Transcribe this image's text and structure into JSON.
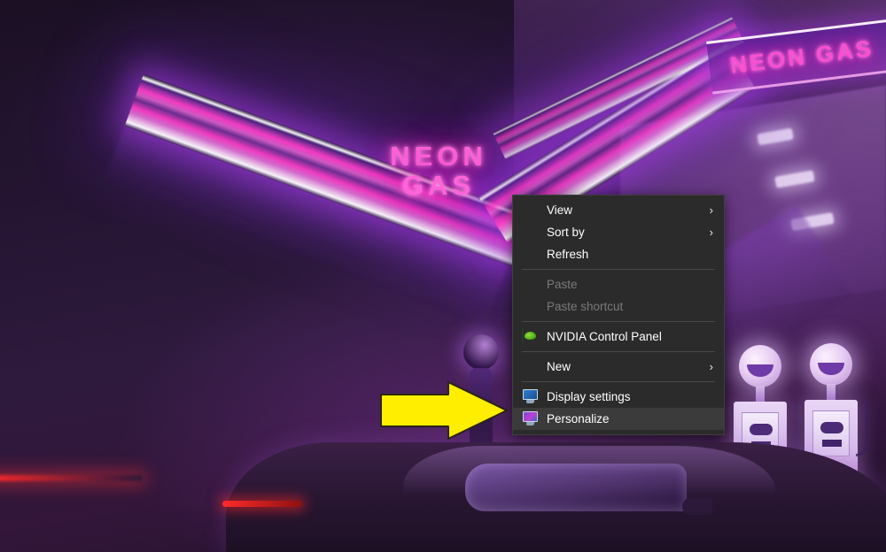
{
  "wallpaper": {
    "scene_name": "neon-gas-station-synthwave",
    "signs": [
      {
        "id": "center-sign",
        "line1": "NEON",
        "line2": "GAS",
        "color": "#ff63d9"
      },
      {
        "id": "corner-sign",
        "text": "NEON GAS",
        "color": "#f94fd0"
      }
    ],
    "accent_colors": {
      "neon_pink": "#ff3ec4",
      "neon_purple": "#8a3ddb",
      "background_dark": "#1b1024",
      "tail_light_red": "#ff2a2a"
    }
  },
  "annotation": {
    "arrow": {
      "name": "yellow-right-arrow",
      "direction": "right",
      "fill": "#ffee00",
      "stroke": "#2a2416",
      "points_at": "Personalize"
    }
  },
  "context_menu": {
    "name": "desktop-context-menu",
    "background": "#2b2b2b",
    "border": "#3f3f3f",
    "items": [
      {
        "label": "View",
        "icon": "none",
        "submenu": true,
        "disabled": false,
        "highlight": false,
        "chevron": "›"
      },
      {
        "label": "Sort by",
        "icon": "none",
        "submenu": true,
        "disabled": false,
        "highlight": false,
        "chevron": "›"
      },
      {
        "label": "Refresh",
        "icon": "none",
        "submenu": false,
        "disabled": false,
        "highlight": false,
        "chevron": ""
      },
      {
        "label": "Paste",
        "icon": "none",
        "submenu": false,
        "disabled": true,
        "highlight": false,
        "chevron": ""
      },
      {
        "label": "Paste shortcut",
        "icon": "none",
        "submenu": false,
        "disabled": true,
        "highlight": false,
        "chevron": ""
      },
      {
        "label": "NVIDIA Control Panel",
        "icon": "nvidia-icon",
        "submenu": false,
        "disabled": false,
        "highlight": false,
        "chevron": ""
      },
      {
        "label": "New",
        "icon": "none",
        "submenu": true,
        "disabled": false,
        "highlight": false,
        "chevron": "›"
      },
      {
        "label": "Display settings",
        "icon": "display-monitor-icon",
        "submenu": false,
        "disabled": false,
        "highlight": false,
        "chevron": ""
      },
      {
        "label": "Personalize",
        "icon": "personalize-monitor-icon",
        "submenu": false,
        "disabled": false,
        "highlight": true,
        "chevron": ""
      }
    ]
  }
}
